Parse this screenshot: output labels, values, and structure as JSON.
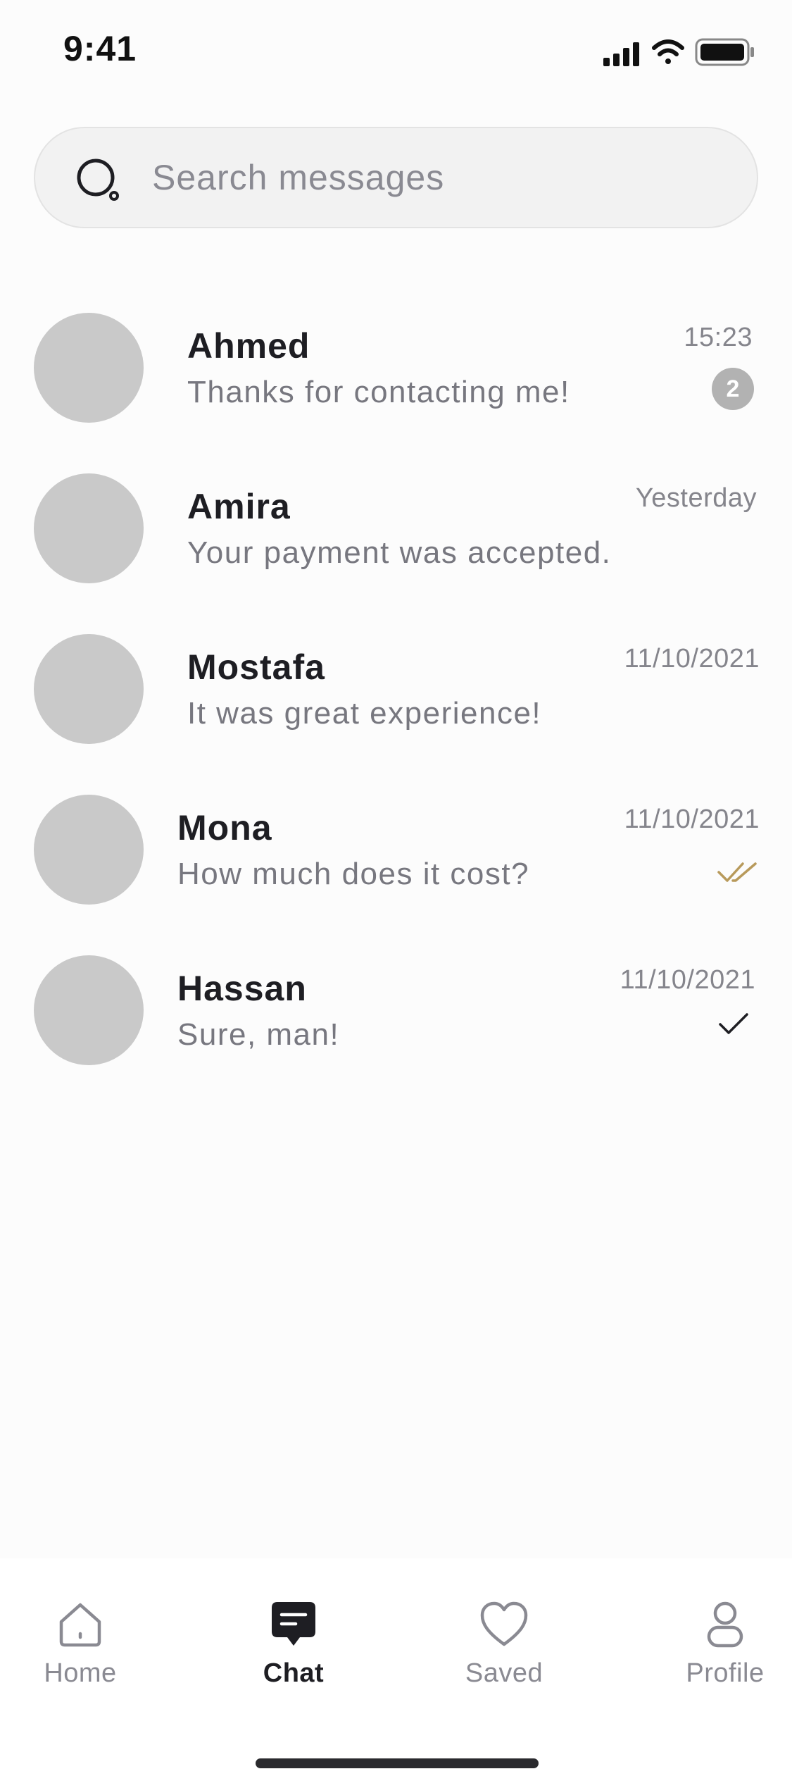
{
  "status_bar": {
    "time": "9:41"
  },
  "search": {
    "placeholder": "Search messages"
  },
  "chats": [
    {
      "name": "Ahmed",
      "preview": "Thanks for contacting me!",
      "time": "15:23",
      "unread": "2"
    },
    {
      "name": "Amira",
      "preview": "Your payment was accepted.",
      "time": "Yesterday"
    },
    {
      "name": "Mostafa",
      "preview": "It was great experience!",
      "time": "11/10/2021"
    },
    {
      "name": "Mona",
      "preview": "How much does it cost?",
      "time": "11/10/2021",
      "status": "read",
      "status_icon": "double-check-icon"
    },
    {
      "name": "Hassan",
      "preview": "Sure, man!",
      "time": "11/10/2021",
      "status": "sent",
      "status_icon": "check-icon"
    }
  ],
  "tabbar": {
    "items": [
      {
        "label": "Home",
        "icon": "home-icon"
      },
      {
        "label": "Chat",
        "icon": "chat-icon",
        "active": true
      },
      {
        "label": "Saved",
        "icon": "heart-icon"
      },
      {
        "label": "Profile",
        "icon": "user-icon"
      }
    ]
  },
  "colors": {
    "accent_read": "#b89a5b",
    "avatar_placeholder": "#c9c9c9",
    "badge": "#b2b2b2",
    "text_primary": "#1e1e23",
    "text_secondary": "#77777f"
  }
}
